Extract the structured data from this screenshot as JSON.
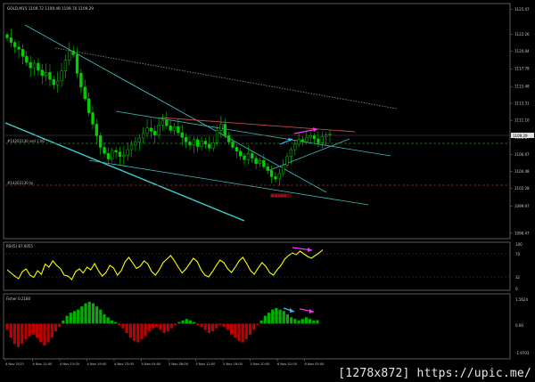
{
  "header": {
    "symbol_line": "GOLD,M15  1109.72 1109.49 1109.70 1109.29"
  },
  "price_axis_labels": [
    "1125.47",
    "1122.26",
    "1120.04",
    "1117.78",
    "1115.48",
    "1113.31",
    "1111.10",
    "1108.87",
    "1106.67",
    "1104.48",
    "1102.28",
    "1099.97",
    "1096.47"
  ],
  "current_price_tag": "1109.29",
  "annotations": {
    "sell_label": "#14203130 sell 1.00",
    "tp_label": "#14203130 tp",
    "red_marker_label": "0001000"
  },
  "rsi_panel": {
    "title": "RSI(5) 87.0055",
    "levels": [
      "100",
      "70",
      "32",
      "0"
    ]
  },
  "fisher_panel": {
    "title": "Fisher 0.2180",
    "levels": [
      "1.5624",
      "0.00",
      "-1.9703"
    ]
  },
  "time_axis_labels": [
    "4 Nov 2015",
    "4 Nov 11:00",
    "4 Nov 15:00",
    "4 Nov 19:00",
    "4 Nov 23:00",
    "5 Nov 04:00",
    "5 Nov 08:00",
    "5 Nov 12:00",
    "5 Nov 16:00",
    "5 Nov 20:00",
    "6 Nov 01:00",
    "6 Nov 05:00"
  ],
  "watermark": "[1278x872] https://upic.me/",
  "colors": {
    "background": "#000000",
    "candles_up": "#00d000",
    "candles_down": "#00d000",
    "rsi_line": "#ffff00",
    "fisher_up": "#00b000",
    "fisher_down": "#c00000",
    "trendline": "#40c0c0",
    "resistance": "#c04040",
    "arrows": [
      "#ff30ff",
      "#30c0ff"
    ]
  },
  "chart_data": [
    {
      "type": "candlestick",
      "title": "GOLD,M15",
      "ylim": [
        1096.0,
        1126.0
      ],
      "close_series": [
        1121.8,
        1121.2,
        1120.6,
        1120.3,
        1119.4,
        1118.6,
        1117.9,
        1118.5,
        1117.6,
        1116.9,
        1117.3,
        1116.4,
        1115.7,
        1116.2,
        1117.5,
        1118.9,
        1120.1,
        1119.6,
        1117.2,
        1115.4,
        1113.9,
        1112.1,
        1110.6,
        1109.1,
        1107.6,
        1106.8,
        1106.1,
        1107.2,
        1107.0,
        1106.4,
        1106.6,
        1107.3,
        1107.9,
        1108.3,
        1108.8,
        1109.4,
        1110.1,
        1109.7,
        1109.2,
        1110.5,
        1111.1,
        1110.4,
        1109.8,
        1110.3,
        1109.5,
        1108.9,
        1108.3,
        1107.9,
        1108.6,
        1107.7,
        1108.4,
        1108.0,
        1107.5,
        1108.2,
        1109.8,
        1110.6,
        1109.1,
        1108.3,
        1107.6,
        1107.1,
        1106.5,
        1106.0,
        1106.8,
        1106.2,
        1105.5,
        1105.9,
        1105.1,
        1104.6,
        1103.8,
        1103.5,
        1104.2,
        1105.3,
        1106.4,
        1107.3,
        1108.0,
        1108.6,
        1108.3,
        1108.9,
        1109.1,
        1108.7,
        1108.2,
        1109.0,
        1109.2,
        1109.29
      ],
      "resistance_level": 1111.2,
      "sell_level": 1108.3,
      "tp_level": 1103.0
    },
    {
      "type": "line",
      "title": "RSI(5) 87.0055",
      "ylim": [
        0,
        100
      ],
      "levels": [
        30,
        70
      ],
      "values": [
        42,
        35,
        28,
        22,
        38,
        44,
        30,
        25,
        40,
        32,
        55,
        48,
        62,
        52,
        45,
        30,
        28,
        20,
        38,
        44,
        35,
        48,
        42,
        56,
        40,
        28,
        36,
        52,
        46,
        30,
        40,
        60,
        70,
        58,
        45,
        50,
        62,
        55,
        38,
        30,
        42,
        58,
        66,
        74,
        62,
        48,
        35,
        44,
        56,
        68,
        60,
        42,
        30,
        26,
        38,
        52,
        64,
        58,
        44,
        36,
        48,
        62,
        70,
        56,
        40,
        32,
        46,
        58,
        50,
        36,
        30,
        42,
        52,
        66,
        74,
        80,
        76,
        84,
        78,
        72,
        68,
        74,
        80,
        87
      ]
    },
    {
      "type": "bar",
      "title": "Fisher 0.2180",
      "ylim": [
        -1.9703,
        1.5624
      ],
      "values": [
        -0.4,
        -0.9,
        -1.3,
        -1.5,
        -1.3,
        -1.0,
        -0.8,
        -0.7,
        -0.9,
        -1.2,
        -1.4,
        -1.2,
        -0.9,
        -0.5,
        -0.2,
        0.2,
        0.5,
        0.7,
        0.8,
        0.9,
        1.1,
        1.3,
        1.4,
        1.3,
        1.1,
        0.9,
        0.6,
        0.4,
        0.2,
        0.1,
        -0.1,
        -0.3,
        -0.6,
        -0.9,
        -1.1,
        -1.2,
        -1.0,
        -0.8,
        -0.5,
        -0.3,
        -0.2,
        -0.4,
        -0.6,
        -0.5,
        -0.3,
        -0.1,
        0.1,
        0.2,
        0.3,
        0.2,
        0.1,
        -0.1,
        -0.2,
        -0.4,
        -0.6,
        -0.5,
        -0.3,
        -0.1,
        -0.2,
        -0.4,
        -0.7,
        -0.9,
        -1.1,
        -1.2,
        -1.0,
        -0.7,
        -0.4,
        -0.1,
        0.2,
        0.5,
        0.7,
        0.9,
        1.0,
        0.9,
        0.8,
        0.6,
        0.4,
        0.3,
        0.2,
        0.3,
        0.4,
        0.3,
        0.2,
        0.22
      ]
    }
  ]
}
